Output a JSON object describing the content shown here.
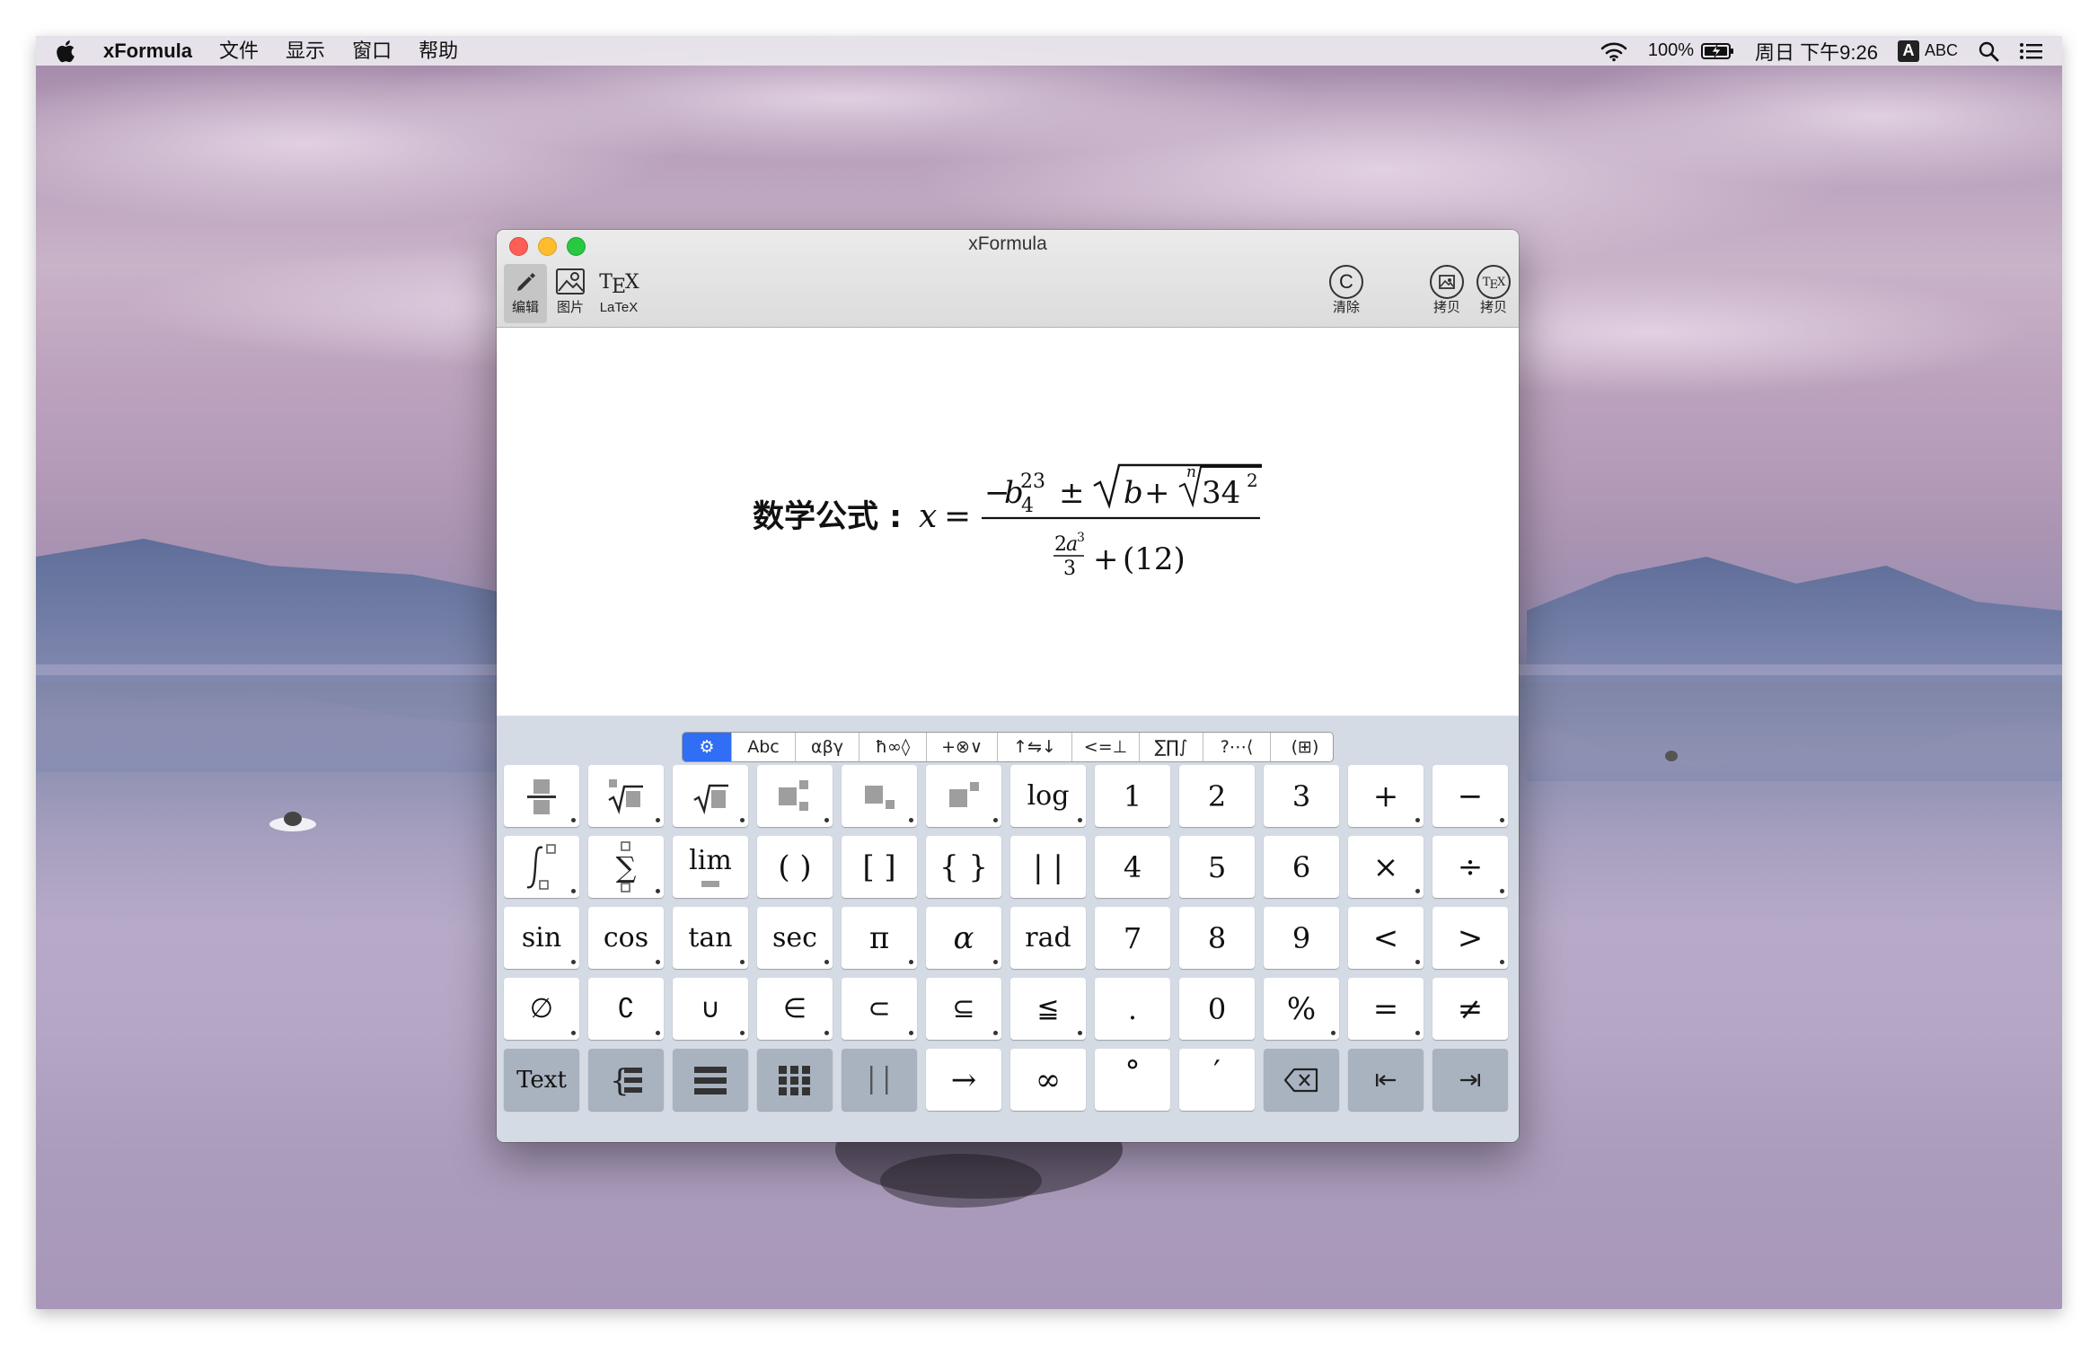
{
  "menubar": {
    "app_name": "xFormula",
    "menus": [
      "文件",
      "显示",
      "窗口",
      "帮助"
    ],
    "battery": "100%",
    "clock": "周日 下午9:26",
    "input_source_letter": "A",
    "input_source": "ABC"
  },
  "window": {
    "title": "xFormula",
    "toolbar": {
      "edit_label": "编辑",
      "image_label": "图片",
      "latex_label": "LaTeX",
      "clear_label": "清除",
      "copy_image_label": "拷贝",
      "copy_latex_label": "拷贝"
    }
  },
  "formula": {
    "prefix": "数学公式 : ",
    "latex_shown": "x = (−b_4^{23} ± √(b + ∛n(34^2))) / (2a^3/3 + (12))"
  },
  "keyboard": {
    "categories": [
      "⚙",
      "Abc",
      "αβγ",
      "ħ∞◊",
      "+⊗∨",
      "↑⇋↓",
      "<=⊥",
      "∑∏∫",
      "?⋯⟨",
      "(⊞)"
    ],
    "active_category": 0,
    "rows": [
      [
        "fraction",
        "nth-root",
        "sqrt",
        "superscript-subscript",
        "subscript",
        "superscript",
        "log",
        "1",
        "2",
        "3",
        "+",
        "−"
      ],
      [
        "integral",
        "sum",
        "lim",
        "( )",
        "[ ]",
        "{ }",
        "| |",
        "4",
        "5",
        "6",
        "×",
        "÷"
      ],
      [
        "sin",
        "cos",
        "tan",
        "sec",
        "π",
        "α",
        "rad",
        "7",
        "8",
        "9",
        "<",
        ">"
      ],
      [
        "∅",
        "∁",
        "∪",
        "∈",
        "⊂",
        "⊆",
        "≦",
        ".",
        "0",
        "%",
        "=",
        "≠"
      ],
      [
        "Text",
        "cases",
        "rows",
        "matrix",
        "separator",
        "→",
        "∞",
        "°",
        "′",
        "backspace",
        "move-left",
        "move-right"
      ]
    ],
    "labels": {
      "log": "log",
      "lim": "lim",
      "sin": "sin",
      "cos": "cos",
      "tan": "tan",
      "sec": "sec",
      "rad": "rad",
      "text": "Text",
      "paren": "( )",
      "bracket": "[ ]",
      "brace": "{ }",
      "abs": "| |"
    }
  }
}
